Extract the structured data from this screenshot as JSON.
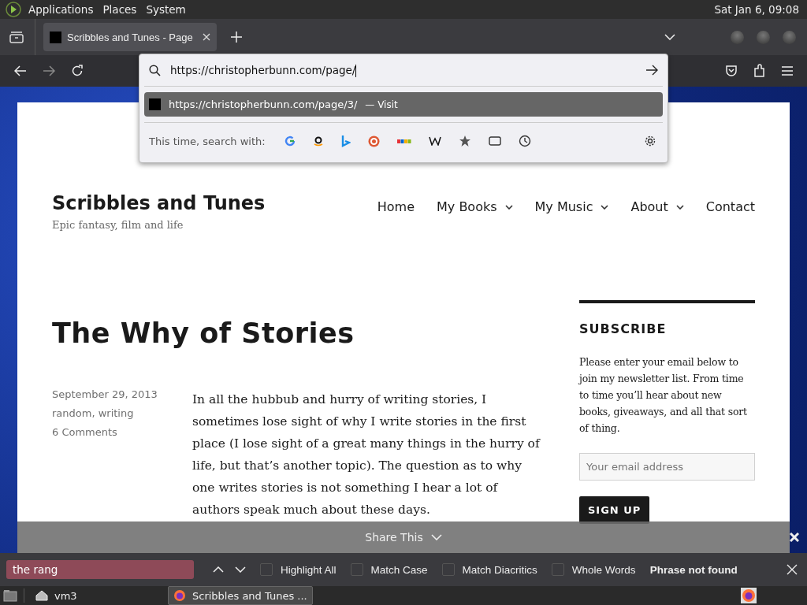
{
  "top_panel": {
    "menus": [
      "Applications",
      "Places",
      "System"
    ],
    "clock": "Sat Jan  6, 09:08"
  },
  "tabs": [
    {
      "title": "Scribbles and Tunes - Page",
      "selected": true
    }
  ],
  "url_bar": {
    "value": "https://christopherbunn.com/page/",
    "suggestion": {
      "url": "https://christopherbunn.com/page/3/",
      "action": "— Visit",
      "selected": true
    },
    "search_label": "This time, search with:"
  },
  "page": {
    "site_title": "Scribbles and Tunes",
    "tagline": "Epic fantasy, film and life",
    "nav": [
      {
        "label": "Home",
        "has_submenu": false
      },
      {
        "label": "My Books",
        "has_submenu": true
      },
      {
        "label": "My Music",
        "has_submenu": true
      },
      {
        "label": "About",
        "has_submenu": true
      },
      {
        "label": "Contact",
        "has_submenu": false
      }
    ],
    "post": {
      "title": "The Why of Stories",
      "date": "September 29, 2013",
      "categories": "random, writing",
      "comments": "6 Comments",
      "paragraph": "In all the hubbub and hurry of writing stories, I sometimes lose sight of why I write stories in the first place (I lose sight of a great many things in the hurry of life, but that’s another topic). The question as to why one writes stories is not something I hear a lot of authors speak much about these days."
    },
    "sidebar": {
      "heading": "SUBSCRIBE",
      "text": "Please enter your email below to join my newsletter list. From time to time you’ll hear about new books, giveaways, and all that sort of thing.",
      "email_placeholder": "Your email address",
      "button": "SIGN UP"
    },
    "share_bar": {
      "label": "Share This"
    }
  },
  "find_bar": {
    "value": "the rang",
    "not_found": true,
    "options": [
      {
        "label": "Highlight All",
        "checked": false
      },
      {
        "label": "Match Case",
        "checked": false
      },
      {
        "label": "Match Diacritics",
        "checked": false
      },
      {
        "label": "Whole Words",
        "checked": false
      }
    ],
    "status": "Phrase not found"
  },
  "taskbar": {
    "items": [
      {
        "kind": "folder",
        "label": "vm3",
        "selected": false
      },
      {
        "kind": "browser",
        "label": "Scribbles and Tunes ...",
        "selected": true
      }
    ]
  }
}
